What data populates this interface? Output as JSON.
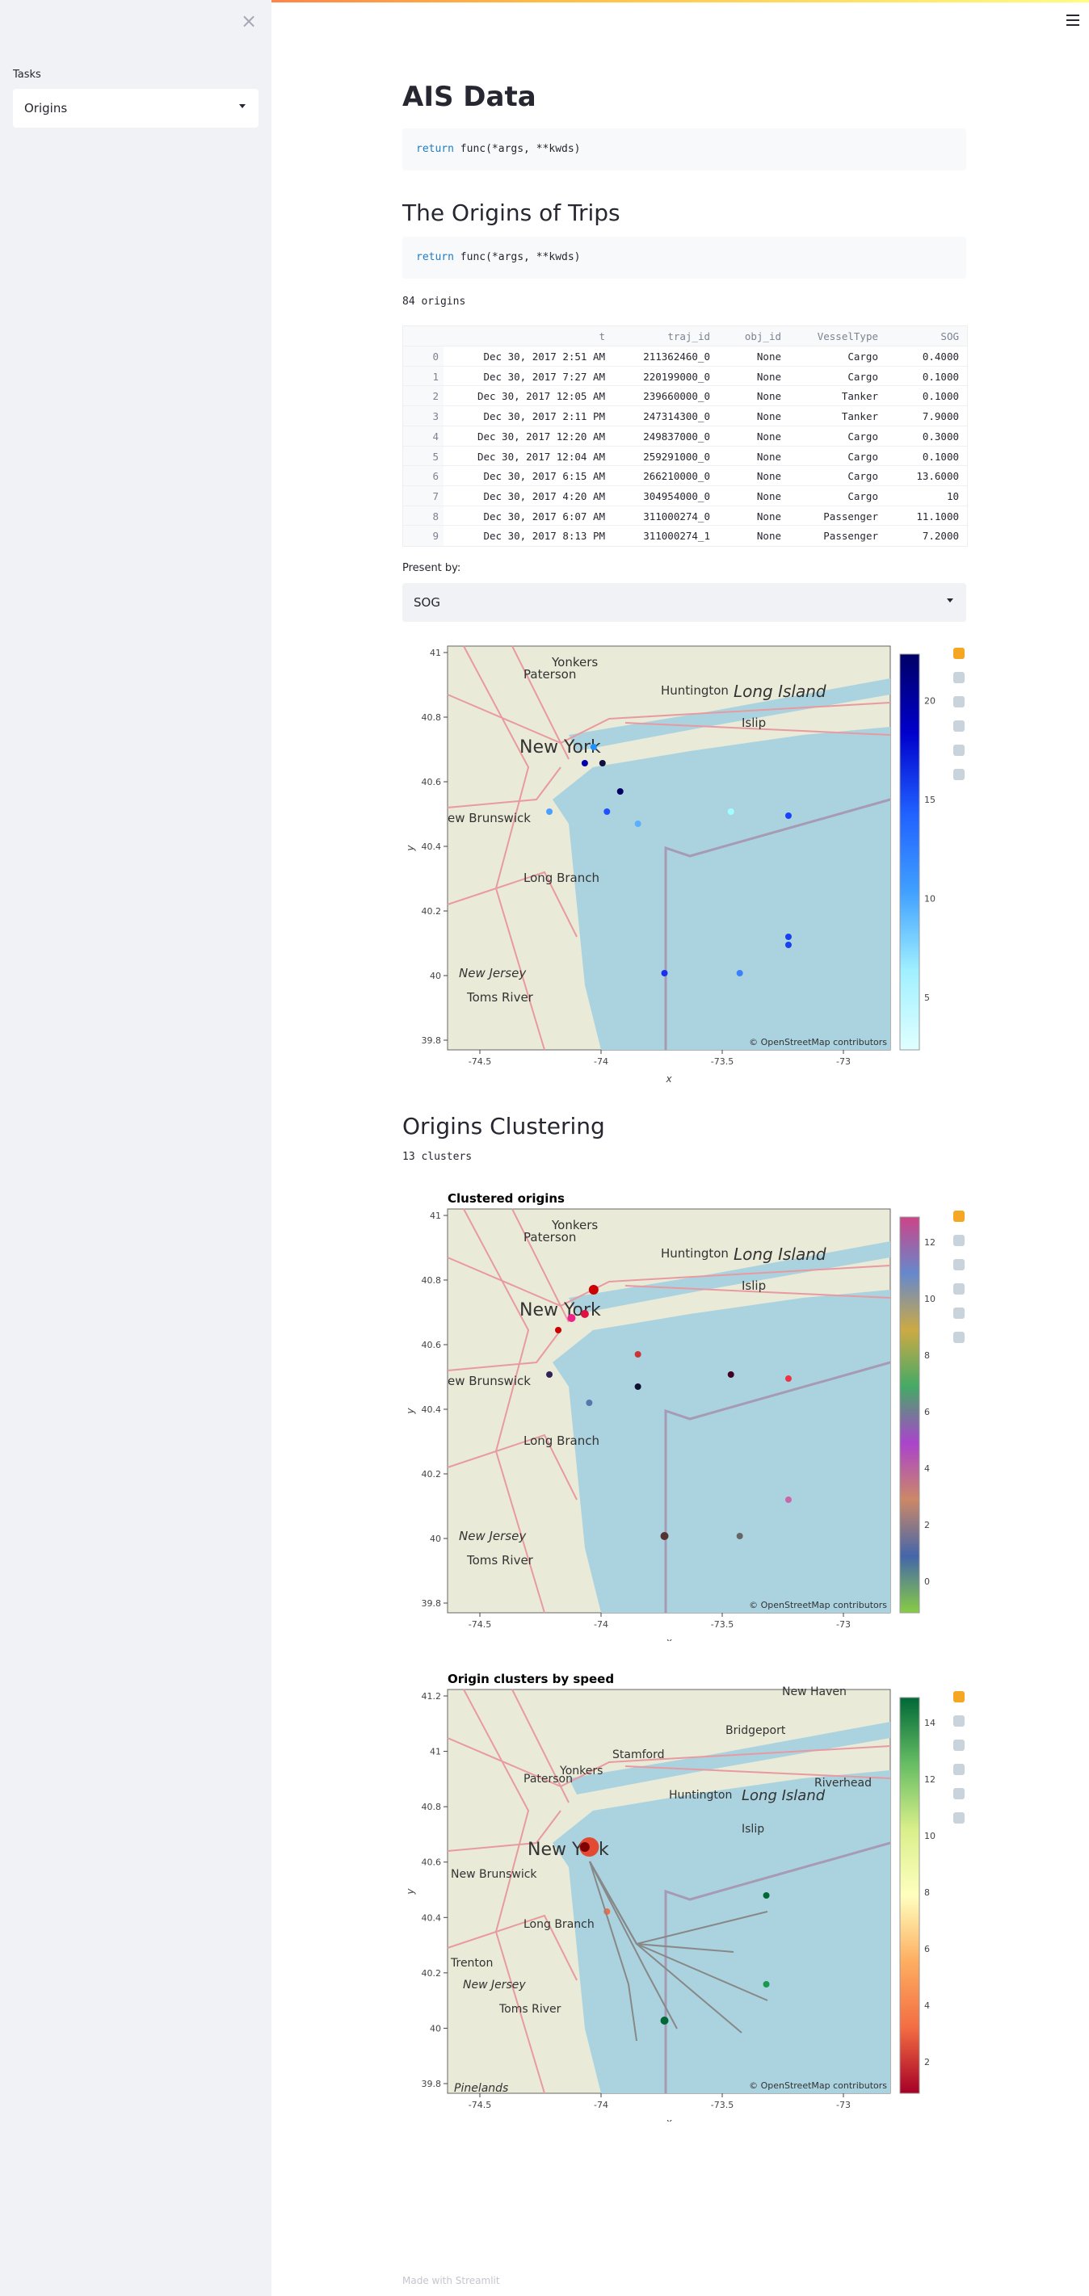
{
  "sidebar": {
    "close_glyph": "×",
    "tasks_label": "Tasks",
    "task_value": "Origins"
  },
  "menu_icon": "hamburger-menu-icon",
  "header": {
    "title": "AIS Data"
  },
  "code_blocks": [
    {
      "keyword": "return",
      "rest": " func(*args, **kwds)"
    },
    {
      "keyword": "return",
      "rest": " func(*args, **kwds)"
    }
  ],
  "section_origins": {
    "title": "The Origins of Trips",
    "count_text": "84 origins"
  },
  "table": {
    "columns": [
      "t",
      "traj_id",
      "obj_id",
      "VesselType",
      "SOG"
    ],
    "rows": [
      {
        "idx": "0",
        "t": "Dec 30, 2017 2:51 AM",
        "traj_id": "211362460_0",
        "obj_id": "None",
        "vt": "Cargo",
        "sog": "0.4000"
      },
      {
        "idx": "1",
        "t": "Dec 30, 2017 7:27 AM",
        "traj_id": "220199000_0",
        "obj_id": "None",
        "vt": "Cargo",
        "sog": "0.1000"
      },
      {
        "idx": "2",
        "t": "Dec 30, 2017 12:05 AM",
        "traj_id": "239660000_0",
        "obj_id": "None",
        "vt": "Tanker",
        "sog": "0.1000"
      },
      {
        "idx": "3",
        "t": "Dec 30, 2017 2:11 PM",
        "traj_id": "247314300_0",
        "obj_id": "None",
        "vt": "Tanker",
        "sog": "7.9000"
      },
      {
        "idx": "4",
        "t": "Dec 30, 2017 12:20 AM",
        "traj_id": "249837000_0",
        "obj_id": "None",
        "vt": "Cargo",
        "sog": "0.3000"
      },
      {
        "idx": "5",
        "t": "Dec 30, 2017 12:04 AM",
        "traj_id": "259291000_0",
        "obj_id": "None",
        "vt": "Cargo",
        "sog": "0.1000"
      },
      {
        "idx": "6",
        "t": "Dec 30, 2017 6:15 AM",
        "traj_id": "266210000_0",
        "obj_id": "None",
        "vt": "Cargo",
        "sog": "13.6000"
      },
      {
        "idx": "7",
        "t": "Dec 30, 2017 4:20 AM",
        "traj_id": "304954000_0",
        "obj_id": "None",
        "vt": "Cargo",
        "sog": "10"
      },
      {
        "idx": "8",
        "t": "Dec 30, 2017 6:07 AM",
        "traj_id": "311000274_0",
        "obj_id": "None",
        "vt": "Passenger",
        "sog": "11.1000"
      },
      {
        "idx": "9",
        "t": "Dec 30, 2017 8:13 PM",
        "traj_id": "311000274_1",
        "obj_id": "None",
        "vt": "Passenger",
        "sog": "7.2000"
      }
    ]
  },
  "present_by": {
    "label": "Present by:",
    "value": "SOG"
  },
  "section_clustering": {
    "title": "Origins Clustering",
    "count_text": "13 clusters"
  },
  "plot1": {
    "xlabel": "x",
    "ylabel": "y",
    "xticks": [
      "-74.5",
      "-74",
      "-73.5",
      "-73"
    ],
    "yticks": [
      "41",
      "40.8",
      "40.6",
      "40.4",
      "40.2",
      "40",
      "39.8"
    ],
    "cbar_ticks": [
      "20",
      "15",
      "10",
      "5"
    ],
    "attribution": "© OpenStreetMap contributors",
    "places": [
      "Paterson",
      "Yonkers",
      "Huntington",
      "Long Island",
      "New York",
      "Islip",
      "ew Brunswick",
      "Long Branch",
      "New Jersey",
      "Toms River"
    ]
  },
  "plot2": {
    "title": "Clustered origins",
    "xlabel": "x",
    "ylabel": "y",
    "xticks": [
      "-74.5",
      "-74",
      "-73.5",
      "-73"
    ],
    "yticks": [
      "41",
      "40.8",
      "40.6",
      "40.4",
      "40.2",
      "40",
      "39.8"
    ],
    "cbar_ticks": [
      "12",
      "10",
      "8",
      "6",
      "4",
      "2",
      "0"
    ],
    "attribution": "© OpenStreetMap contributors",
    "places": [
      "Paterson",
      "Yonkers",
      "Huntington",
      "Long Island",
      "New York",
      "Islip",
      "ew Brunswick",
      "Long Branch",
      "New Jersey",
      "Toms River"
    ]
  },
  "plot3": {
    "title": "Origin clusters by speed",
    "xlabel": "x",
    "ylabel": "y",
    "xticks": [
      "-74.5",
      "-74",
      "-73.5",
      "-73"
    ],
    "yticks": [
      "41.2",
      "41",
      "40.8",
      "40.6",
      "40.4",
      "40.2",
      "40",
      "39.8"
    ],
    "cbar_ticks": [
      "14",
      "12",
      "10",
      "8",
      "6",
      "4",
      "2"
    ],
    "attribution": "© OpenStreetMap contributors",
    "places": [
      "New Haven",
      "Bridgeport",
      "Stamford",
      "Paterson",
      "Yonkers",
      "Huntington",
      "Long Island",
      "Riverhead",
      "New York",
      "Islip",
      "New Brunswick",
      "Trenton",
      "Long Branch",
      "New Jersey",
      "Toms River",
      "Pinelands"
    ]
  },
  "toolbar_icons": [
    "bokeh-logo-icon",
    "pan-icon",
    "box-zoom-icon",
    "wheel-zoom-icon",
    "reset-icon",
    "hover-icon"
  ],
  "footer": {
    "text": "Made with Streamlit"
  }
}
